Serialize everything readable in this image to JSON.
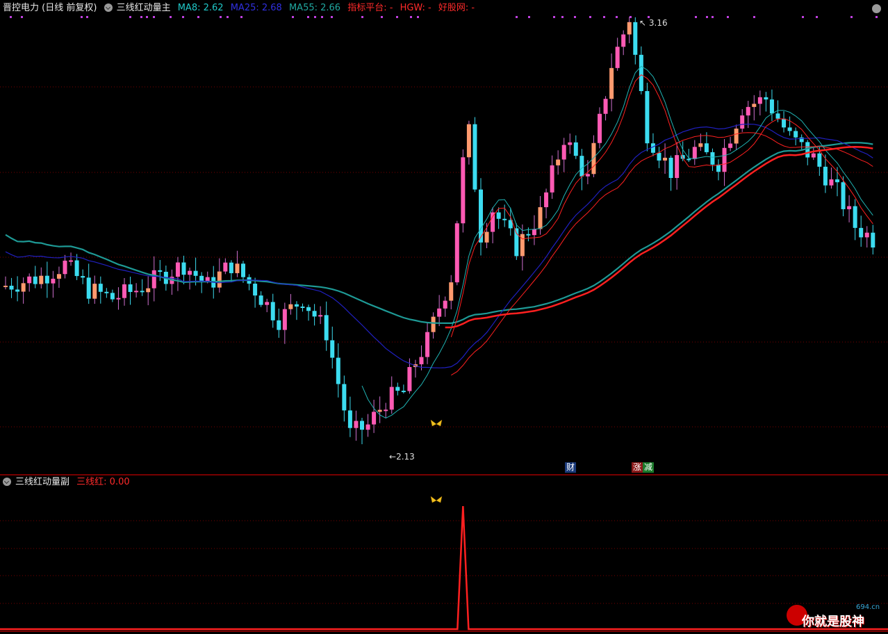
{
  "main_panel": {
    "stock_title": "晋控电力 (日线 前复权)",
    "indicator_name": "三线红动量主",
    "ma8": "MA8: 2.62",
    "ma25": "MA25: 2.68",
    "ma55": "MA55: 2.66",
    "platform": "指标平台: -",
    "hgw": "HGW: -",
    "haogu": "好股网: -",
    "high_label": "3.16",
    "low_label": "2.13",
    "badge_cai": "财",
    "badge_zhang": "涨",
    "badge_jian": "减"
  },
  "sub_panel": {
    "indicator_name": "三线红动量副",
    "value_label": "三线红: 0.00"
  },
  "watermark": {
    "text": "你就是股神",
    "site": "694.cn"
  },
  "colors": {
    "up_candle": "#ff5ab4",
    "up_candle_alt": "#ff9a6e",
    "down_candle": "#3cdcf0",
    "ma8": "#20b4b4",
    "ma25": "#2020c0",
    "ma55": "#1e9a96",
    "signal_red": "#ff2020",
    "grid": "#7a0000",
    "panel_border": "#a00000"
  },
  "chart_data": {
    "type": "candlestick",
    "high": 3.16,
    "low": 2.13,
    "signal_series": {
      "name": "三线红",
      "peak_index": 77,
      "value": 0.0
    }
  }
}
